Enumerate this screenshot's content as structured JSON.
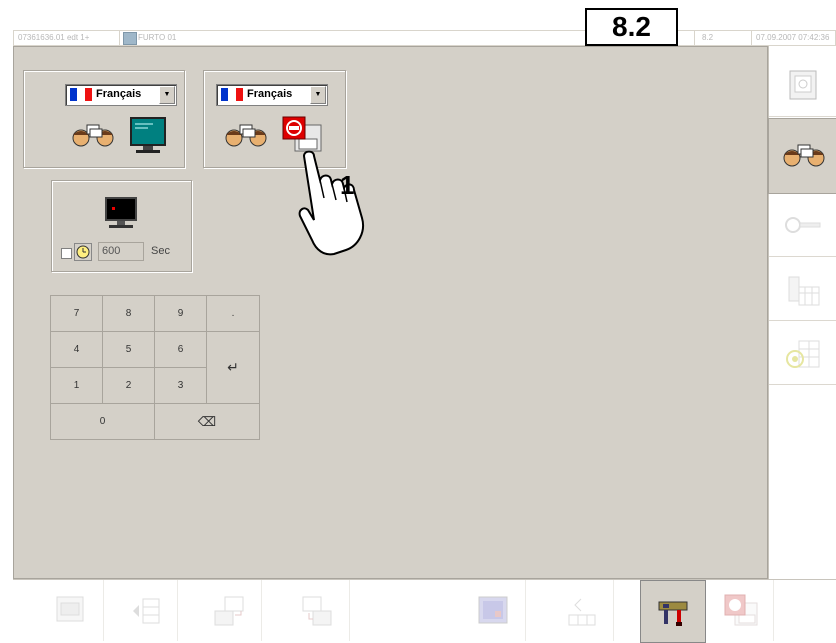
{
  "figure_label": "8.2",
  "titlebar": {
    "left_text": "07361636.01 edt 1+",
    "program": "FURTO 01",
    "mid_text": "8.2",
    "datetime": "07.09.2007 07:42:36"
  },
  "language_groups": [
    {
      "language": "Français",
      "flag_colors": [
        "#0033cc",
        "#ffffff",
        "#ee1111"
      ]
    },
    {
      "language": "Français",
      "flag_colors": [
        "#0033cc",
        "#ffffff",
        "#ee1111"
      ]
    }
  ],
  "screensaver": {
    "enabled": false,
    "timeout_value": "600",
    "unit": "Sec"
  },
  "keypad": {
    "keys": [
      "7",
      "8",
      "9",
      ".",
      "4",
      "5",
      "6",
      "1",
      "2",
      "3",
      "0"
    ],
    "enter_symbol": "↵",
    "backspace_symbol": "⌫"
  },
  "callout": {
    "number": "1"
  },
  "sidebar": {
    "tabs": [
      {
        "icon": "safe-icon",
        "active": false
      },
      {
        "icon": "people-chat-icon",
        "active": true
      },
      {
        "icon": "key-icon",
        "active": false
      },
      {
        "icon": "lubricant-calendar-icon",
        "active": false
      },
      {
        "icon": "target-grid-icon",
        "active": false
      }
    ]
  },
  "bottombar": {
    "buttons": [
      "machine-data-icon",
      "program-edit-icon",
      "program-transfer-icon",
      "program-load-icon",
      "blank",
      "graphics-icon",
      "sheet-transfer-icon",
      "tools-icon",
      "alarm-stop-icon"
    ],
    "pressed_index": 7
  },
  "colors": {
    "panel": "#d4d0c8",
    "accent_teal": "#008080",
    "alarm_red": "#dd0000"
  }
}
